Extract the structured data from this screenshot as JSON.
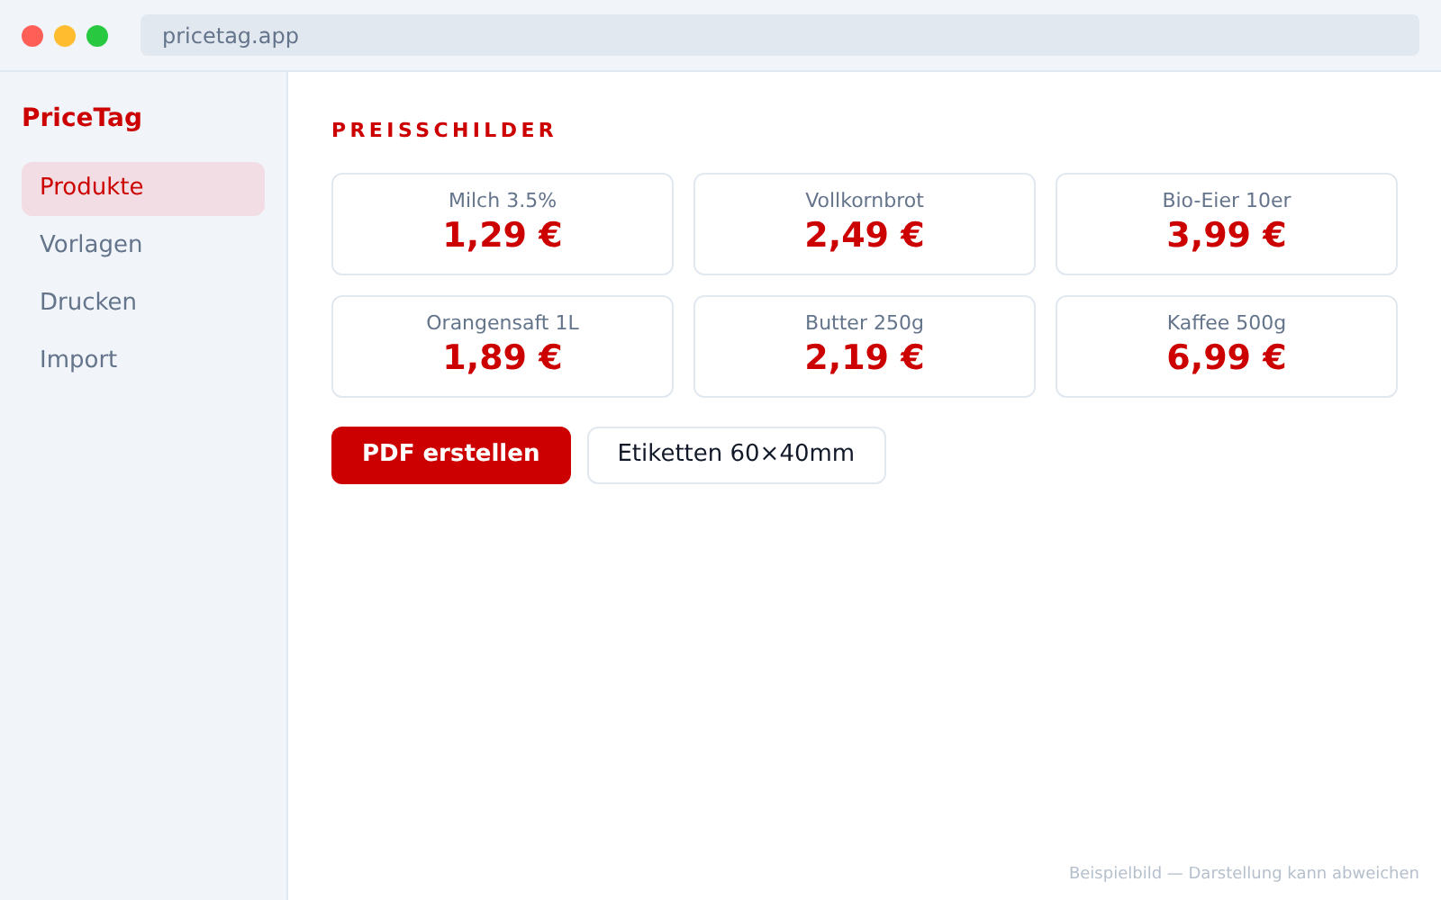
{
  "browser": {
    "url": "pricetag.app"
  },
  "sidebar": {
    "brand": "PriceTag",
    "items": [
      {
        "label": "Produkte",
        "selected": true
      },
      {
        "label": "Vorlagen",
        "selected": false
      },
      {
        "label": "Drucken",
        "selected": false
      },
      {
        "label": "Import",
        "selected": false
      }
    ]
  },
  "main": {
    "heading": "PREISSCHILDER",
    "cards": [
      {
        "name": "Milch 3.5%",
        "price": "1,29 €"
      },
      {
        "name": "Vollkornbrot",
        "price": "2,49 €"
      },
      {
        "name": "Bio-Eier 10er",
        "price": "3,99 €"
      },
      {
        "name": "Orangensaft 1L",
        "price": "1,89 €"
      },
      {
        "name": "Butter 250g",
        "price": "2,19 €"
      },
      {
        "name": "Kaffee 500g",
        "price": "6,99 €"
      }
    ],
    "buttons": [
      {
        "label": "PDF erstellen",
        "kind": "primary"
      },
      {
        "label": "Etiketten 60×40mm",
        "kind": "secondary"
      }
    ]
  },
  "footer_note": "Beispielbild — Darstellung kann abweichen"
}
